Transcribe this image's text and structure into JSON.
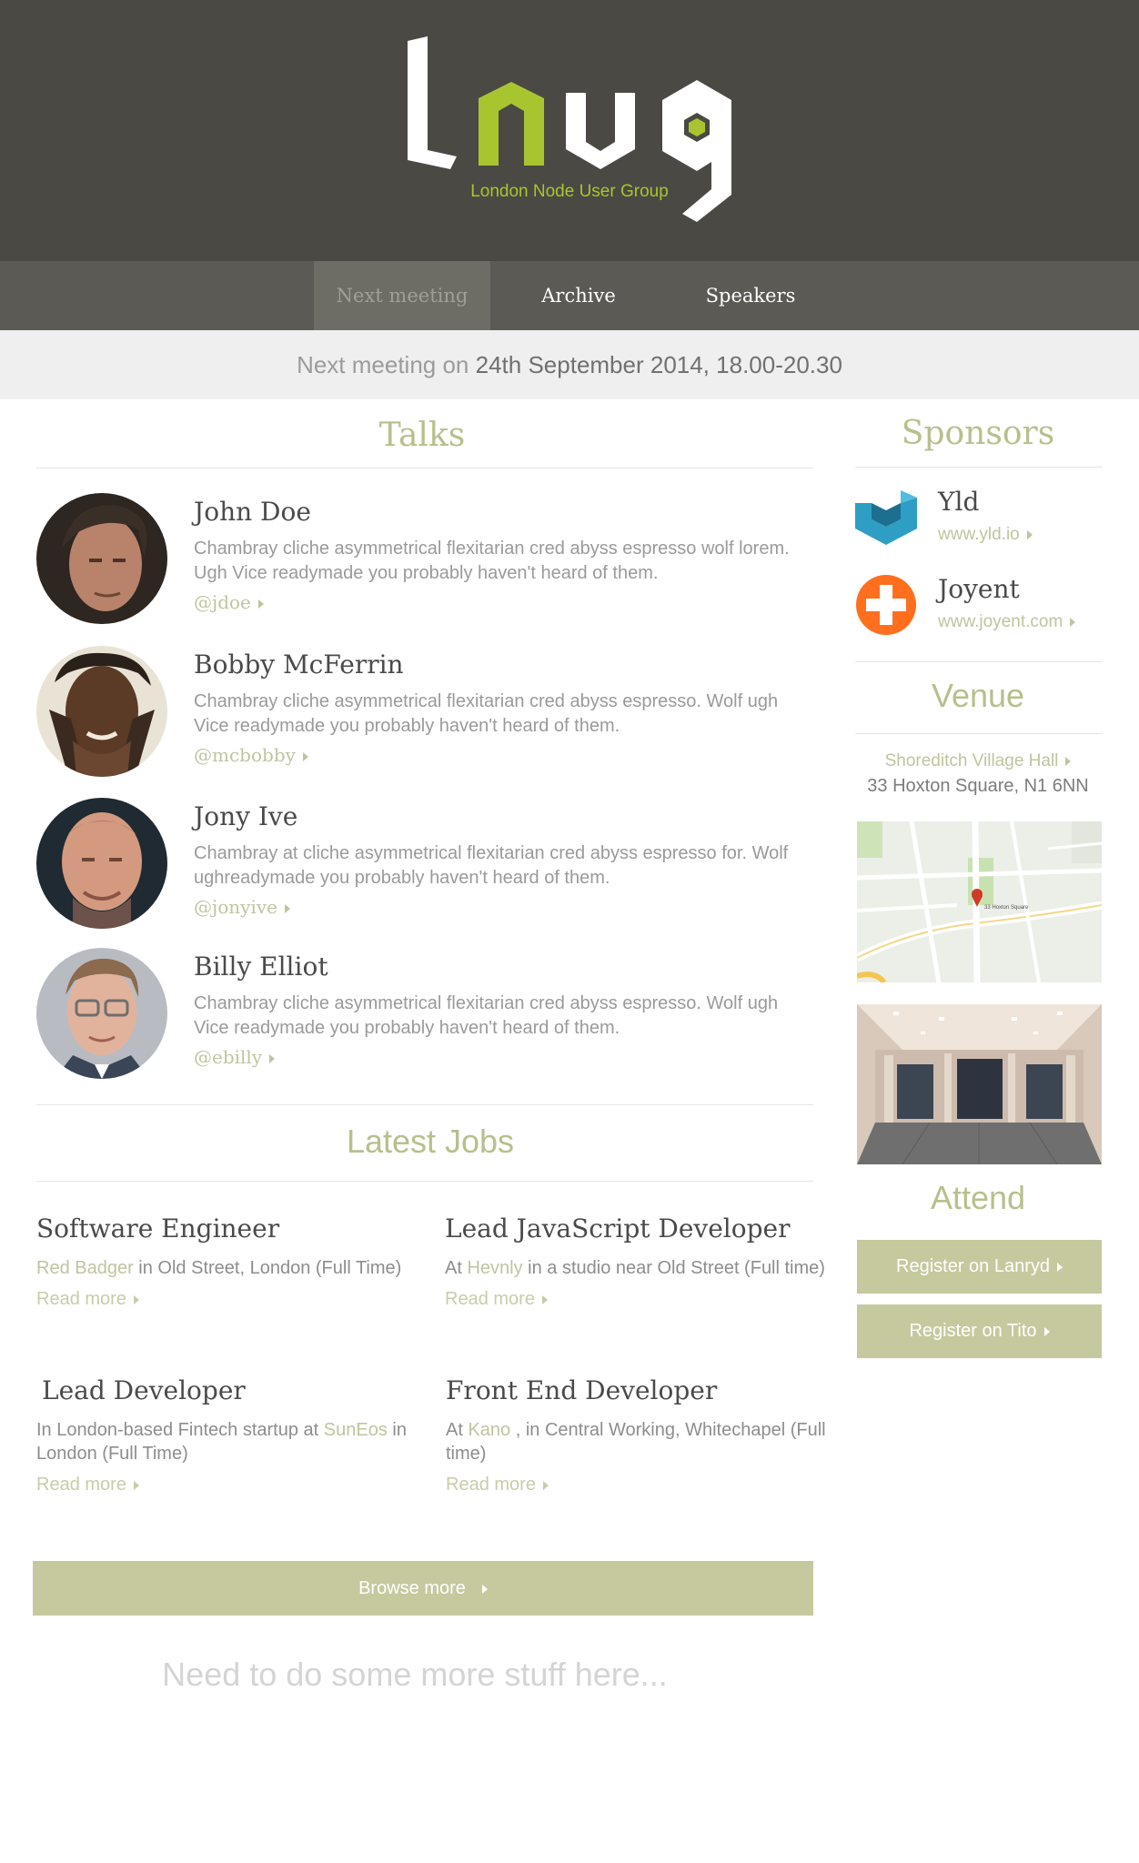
{
  "header": {
    "logo_subtitle": "London Node User Group",
    "logo_text": "Lnug",
    "brand_color": "#a8c530",
    "bg_color": "#4a4943"
  },
  "nav": {
    "items": [
      {
        "label": "Next meeting",
        "active": true
      },
      {
        "label": "Archive",
        "active": false
      },
      {
        "label": "Speakers",
        "active": false
      }
    ]
  },
  "meeting": {
    "prefix": "Next meeting on",
    "date": "24th September 2014, 18.00-20.30"
  },
  "talks": {
    "heading": "Talks",
    "items": [
      {
        "name": "John Doe",
        "description": "Chambray cliche asymmetrical flexitarian cred abyss espresso wolf lorem. Ugh Vice readymade you probably haven't heard of them.",
        "handle": "@jdoe"
      },
      {
        "name": "Bobby McFerrin",
        "description": "Chambray cliche asymmetrical flexitarian cred abyss espresso. Wolf ugh Vice readymade you probably haven't heard of them.",
        "handle": "@mcbobby"
      },
      {
        "name": "Jony Ive",
        "description": "Chambray at cliche asymmetrical flexitarian cred abyss espresso for. Wolf ughreadymade you probably haven't heard of them.",
        "handle": "@jonyive"
      },
      {
        "name": "Billy Elliot",
        "description": "Chambray cliche asymmetrical flexitarian cred abyss espresso. Wolf ugh Vice readymade you probably haven't heard of them.",
        "handle": "@ebilly"
      }
    ]
  },
  "jobs": {
    "heading": "Latest Jobs",
    "read_more": "Read more",
    "items": [
      {
        "title": "Software Engineer",
        "pre": "",
        "company": "Red Badger",
        "post": " in Old Street, London (Full Time)"
      },
      {
        "title": "Lead JavaScript Developer",
        "pre": "At ",
        "company": "Hevnly",
        "post": " in a studio near Old Street (Full time)"
      },
      {
        "title": "Lead Developer",
        "pre": "In London-based Fintech startup at ",
        "company": "SunEos",
        "post": " in London (Full Time)"
      },
      {
        "title": "Front End Developer",
        "pre": "At ",
        "company": "Kano",
        "post": " , in Central Working, Whitechapel (Full time)"
      }
    ],
    "browse_label": "Browse more"
  },
  "footer_note": "Need to do some more stuff here...",
  "sponsors": {
    "heading": "Sponsors",
    "items": [
      {
        "name": "Yld",
        "url": "www.yld.io",
        "icon": "yld-logo-icon"
      },
      {
        "name": "Joyent",
        "url": "www.joyent.com",
        "icon": "joyent-logo-icon"
      }
    ]
  },
  "venue": {
    "heading": "Venue",
    "name": "Shoreditch Village Hall",
    "address": "33 Hoxton Square, N1 6NN",
    "map_label": "33 Hoxton Square"
  },
  "attend": {
    "heading": "Attend",
    "buttons": [
      "Register on Lanryd",
      "Register on Tito"
    ]
  },
  "colors": {
    "accent": "#c6c99e",
    "heading": "#b8bf8d",
    "link": "#c0c49f"
  }
}
